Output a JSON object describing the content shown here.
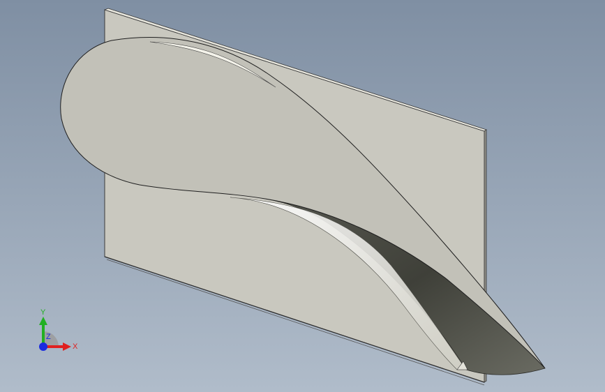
{
  "viewport": {
    "background_top": "#7f8fa3",
    "background_bottom": "#b0bcca"
  },
  "model": {
    "plate_color": "#c9c8bf",
    "plate_edge_color": "#3a3a3a",
    "blade_color": "#c2c1b8",
    "blade_shadow_color": "#3f4039",
    "blade_highlight_color": "#f1f0e6"
  },
  "triad": {
    "x_label": "X",
    "y_label": "Y",
    "z_label": "Z",
    "x_color": "#e02020",
    "y_color": "#22b022",
    "z_color": "#1a2be0"
  }
}
